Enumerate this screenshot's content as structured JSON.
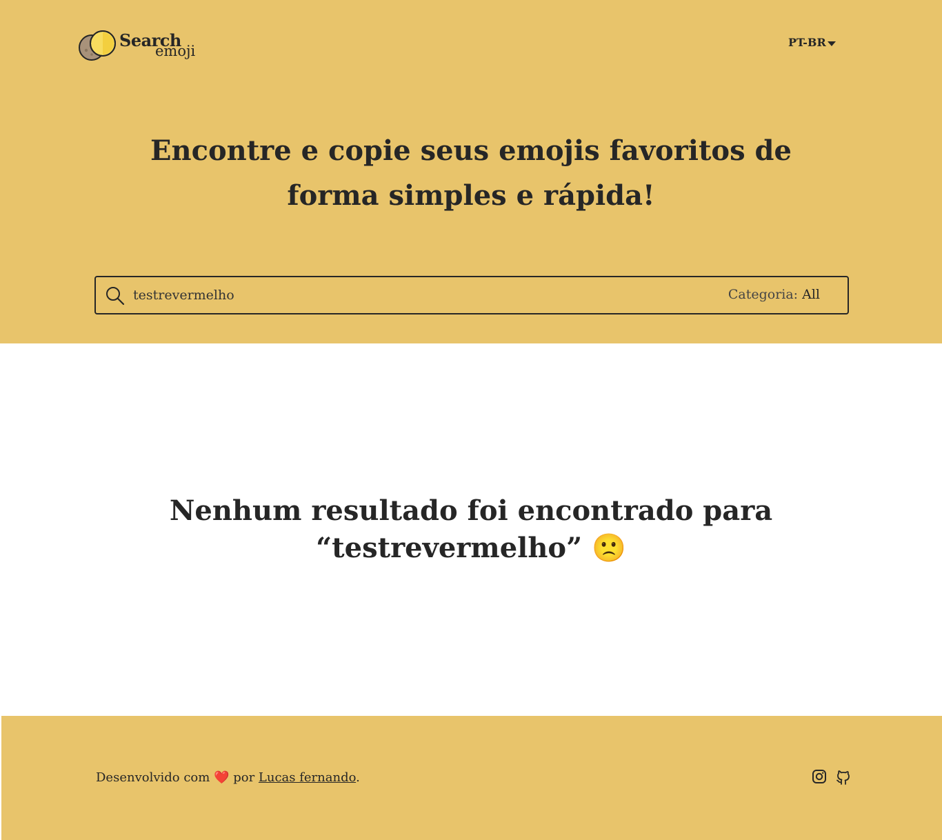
{
  "header": {
    "logo": {
      "word1": "Search",
      "word2": "emoji"
    },
    "language": {
      "selected": "PT-BR"
    },
    "title": "Encontre e copie seus emojis favoritos de forma simples e rápida!"
  },
  "search": {
    "value": "testrevermelho",
    "icon": "search-icon",
    "category_label": "Categoria:",
    "category_value": "All"
  },
  "main": {
    "empty_message": "Nenhum resultado foi encontrado para “testrevermelho” 🙁"
  },
  "footer": {
    "text_prefix": "Desenvolvido com",
    "heart": "❤️",
    "text_middle": "por",
    "author_link": "Lucas fernando",
    "text_suffix": ".",
    "social": [
      "instagram-icon",
      "github-icon"
    ]
  },
  "colors": {
    "accent": "#e8c46b",
    "text": "#262626",
    "background": "#ffffff"
  }
}
